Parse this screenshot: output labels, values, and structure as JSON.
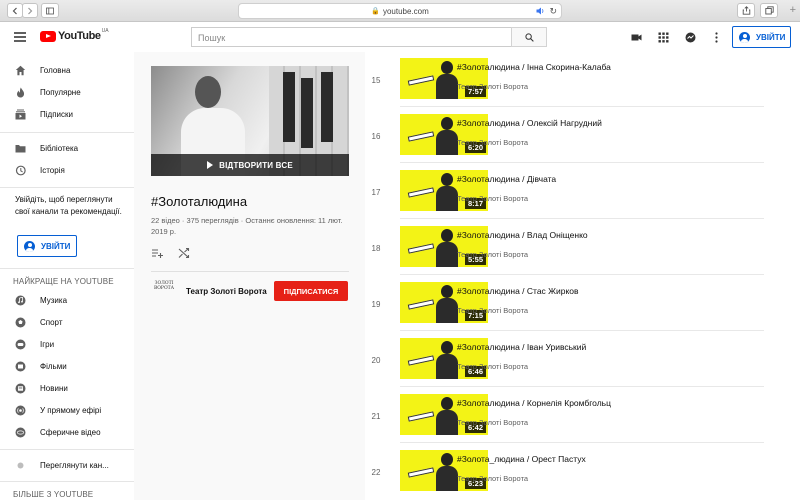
{
  "browser": {
    "url": "youtube.com"
  },
  "header": {
    "logo_text": "YouTube",
    "logo_region": "UA",
    "search_placeholder": "Пошук",
    "signin_label": "УВІЙТИ"
  },
  "sidebar": {
    "main_items": [
      {
        "label": "Головна",
        "icon": "home-icon"
      },
      {
        "label": "Популярне",
        "icon": "fire-icon"
      },
      {
        "label": "Підписки",
        "icon": "subscriptions-icon"
      }
    ],
    "library_items": [
      {
        "label": "Бібліотека",
        "icon": "folder-icon"
      },
      {
        "label": "Історія",
        "icon": "history-icon"
      }
    ],
    "signin_prompt": "Увійдіть, щоб переглянути свої канали та рекомендації.",
    "signin_label": "УВІЙТИ",
    "best_heading": "НАЙКРАЩЕ НА YOUTUBE",
    "best_items": [
      {
        "label": "Музика",
        "icon": "music-icon"
      },
      {
        "label": "Спорт",
        "icon": "sport-icon"
      },
      {
        "label": "Ігри",
        "icon": "gaming-icon"
      },
      {
        "label": "Фільми",
        "icon": "movie-icon"
      },
      {
        "label": "Новини",
        "icon": "news-icon"
      },
      {
        "label": "У прямому ефірі",
        "icon": "live-icon"
      },
      {
        "label": "Сферичне відео",
        "icon": "spherical-video-icon"
      }
    ],
    "browse_channels": "Переглянути кан...",
    "more_heading": "БІЛЬШЕ З YOUTUBE"
  },
  "playlist": {
    "play_all": "ВІДТВОРИТИ ВСЕ",
    "title": "#Золоталюдина",
    "video_count": "22 відео",
    "views": "375 переглядів",
    "updated": "Останнє оновлення: 11 лют. 2019 р.",
    "owner_logo_text": "ЗОЛОТІ ВОРОТА",
    "owner": "Театр Золоті Ворота",
    "subscribe_label": "ПІДПИСАТИСЯ"
  },
  "videos": [
    {
      "index": "15",
      "title": "#Золоталюдина / Інна Скорина-Калаба",
      "channel": "Театр Золоті Ворота",
      "duration": "7:57"
    },
    {
      "index": "16",
      "title": "#Золоталюдина / Олексій Нагрудний",
      "channel": "Театр Золоті Ворота",
      "duration": "6:20"
    },
    {
      "index": "17",
      "title": "#Золоталюдина / Дівчата",
      "channel": "Театр Золоті Ворота",
      "duration": "8:17"
    },
    {
      "index": "18",
      "title": "#Золоталюдина / Влад Оніщенко",
      "channel": "Театр Золоті Ворота",
      "duration": "5:55"
    },
    {
      "index": "19",
      "title": "#Золоталюдина / Стас Жирков",
      "channel": "Театр Золоті Ворота",
      "duration": "7:15"
    },
    {
      "index": "20",
      "title": "#Золоталюдина / Іван Уривський",
      "channel": "Театр Золоті Ворота",
      "duration": "6:46"
    },
    {
      "index": "21",
      "title": "#Золоталюдина / Корнелія Кромбгольц",
      "channel": "Театр Золоті Ворота",
      "duration": "6:42"
    },
    {
      "index": "22",
      "title": "#Золота_людина / Орест Пастух",
      "channel": "Театр Золоті Ворота",
      "duration": "6:23"
    }
  ],
  "colors": {
    "brand_red": "#ff0000",
    "subscribe_red": "#e62117",
    "link_blue": "#065fd4",
    "thumb_yellow": "#f3f316"
  }
}
